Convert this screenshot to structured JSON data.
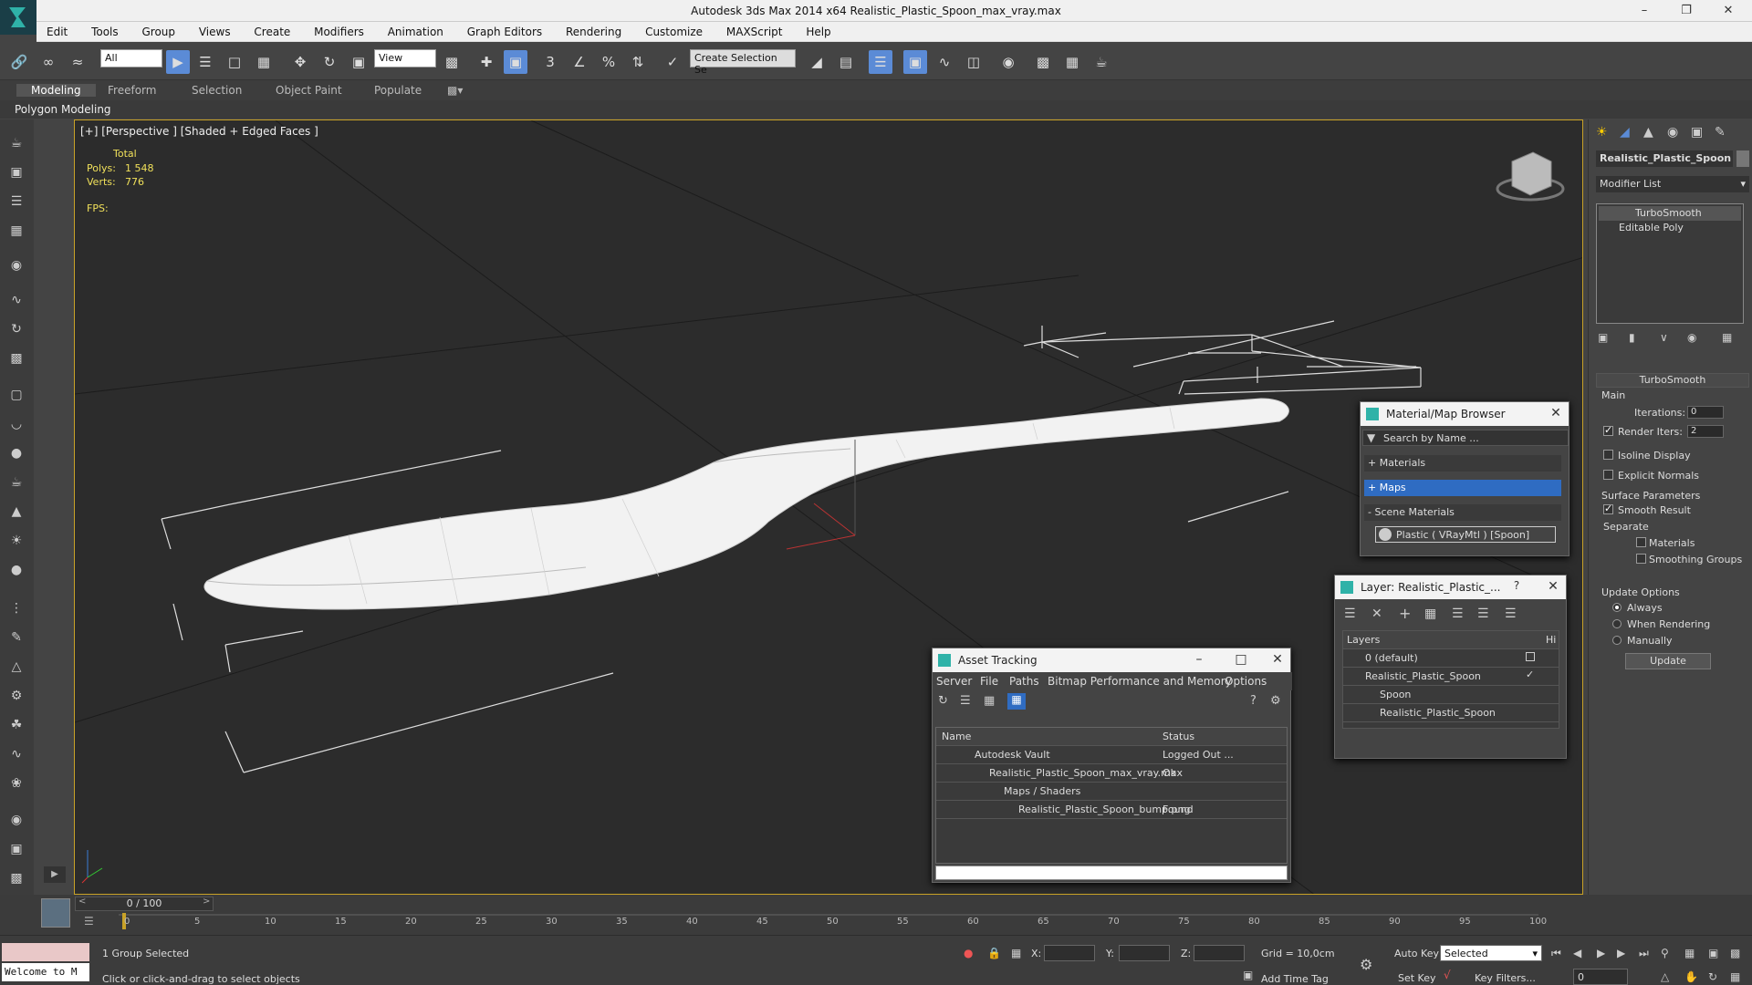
{
  "window": {
    "title": "Autodesk 3ds Max  2014 x64     Realistic_Plastic_Spoon_max_vray.max"
  },
  "menu": [
    "Edit",
    "Tools",
    "Group",
    "Views",
    "Create",
    "Modifiers",
    "Animation",
    "Graph Editors",
    "Rendering",
    "Customize",
    "MAXScript",
    "Help"
  ],
  "toolbar": {
    "filter_value": "All",
    "view_value": "View",
    "selection_set_placeholder": "Create Selection Se"
  },
  "ribbon": {
    "tabs": [
      "Modeling",
      "Freeform",
      "Selection",
      "Object Paint",
      "Populate"
    ],
    "active": "Modeling",
    "subtitle": "Polygon Modeling"
  },
  "viewport": {
    "label": "[+] [Perspective ] [Shaded + Edged Faces ]",
    "stats": {
      "total_label": "Total",
      "polys_label": "Polys:",
      "polys": "1 548",
      "verts_label": "Verts:",
      "verts": "776",
      "fps_label": "FPS:"
    }
  },
  "command_panel": {
    "object_name": "Realistic_Plastic_Spoon",
    "modifier_list_label": "Modifier List",
    "stack": [
      "TurboSmooth",
      "Editable Poly"
    ],
    "rollout_title": "TurboSmooth",
    "main_label": "Main",
    "iterations_label": "Iterations:",
    "iterations": "0",
    "render_iters_label": "Render Iters:",
    "render_iters": "2",
    "isoline_label": "Isoline Display",
    "explicit_normals_label": "Explicit Normals",
    "surface_params_label": "Surface Parameters",
    "smooth_result_label": "Smooth Result",
    "separate_label": "Separate",
    "materials_label": "Materials",
    "smoothing_groups_label": "Smoothing Groups",
    "update_options_label": "Update Options",
    "always_label": "Always",
    "when_rendering_label": "When Rendering",
    "manually_label": "Manually",
    "update_button": "Update"
  },
  "material_browser": {
    "title": "Material/Map Browser",
    "search_placeholder": "Search by Name ...",
    "sections": [
      "+ Materials",
      "+ Maps",
      "- Scene Materials"
    ],
    "scene_material": "Plastic  ( VRayMtl ) [Spoon]"
  },
  "layer_dialog": {
    "title": "Layer: Realistic_Plastic_...",
    "help": "?",
    "header": "Layers",
    "header_hide": "Hi",
    "rows": [
      "0 (default)",
      "Realistic_Plastic_Spoon",
      "Spoon",
      "Realistic_Plastic_Spoon"
    ]
  },
  "asset_tracking": {
    "title": "Asset Tracking",
    "menu": [
      "Server",
      "File",
      "Paths",
      "Bitmap Performance and Memory",
      "Options"
    ],
    "col_name": "Name",
    "col_status": "Status",
    "rows": [
      {
        "name": "Autodesk Vault",
        "status": "Logged Out ..."
      },
      {
        "name": "Realistic_Plastic_Spoon_max_vray.max",
        "status": "Ok"
      },
      {
        "name": "Maps / Shaders",
        "status": ""
      },
      {
        "name": "Realistic_Plastic_Spoon_bump.png",
        "status": "Found"
      }
    ]
  },
  "timeline": {
    "frame": "0 / 100",
    "ticks": [
      "0",
      "5",
      "10",
      "15",
      "20",
      "25",
      "30",
      "35",
      "40",
      "45",
      "50",
      "55",
      "60",
      "65",
      "70",
      "75",
      "80",
      "85",
      "90",
      "95",
      "100"
    ]
  },
  "status": {
    "selection": "1 Group Selected",
    "prompt": "Click or click-and-drag to select objects",
    "script_listener": "Welcome to M",
    "x_label": "X:",
    "y_label": "Y:",
    "z_label": "Z:",
    "grid": "Grid = 10,0cm",
    "auto_key": "Auto Key",
    "set_key": "Set Key",
    "key_mode": "Selected",
    "key_filters": "Key Filters...",
    "add_time_tag": "Add Time Tag",
    "frame_field": "0"
  },
  "colors": {
    "viewport_border": "#c9a227",
    "accent": "#5b8bd6",
    "stats": "#f0e05a"
  }
}
